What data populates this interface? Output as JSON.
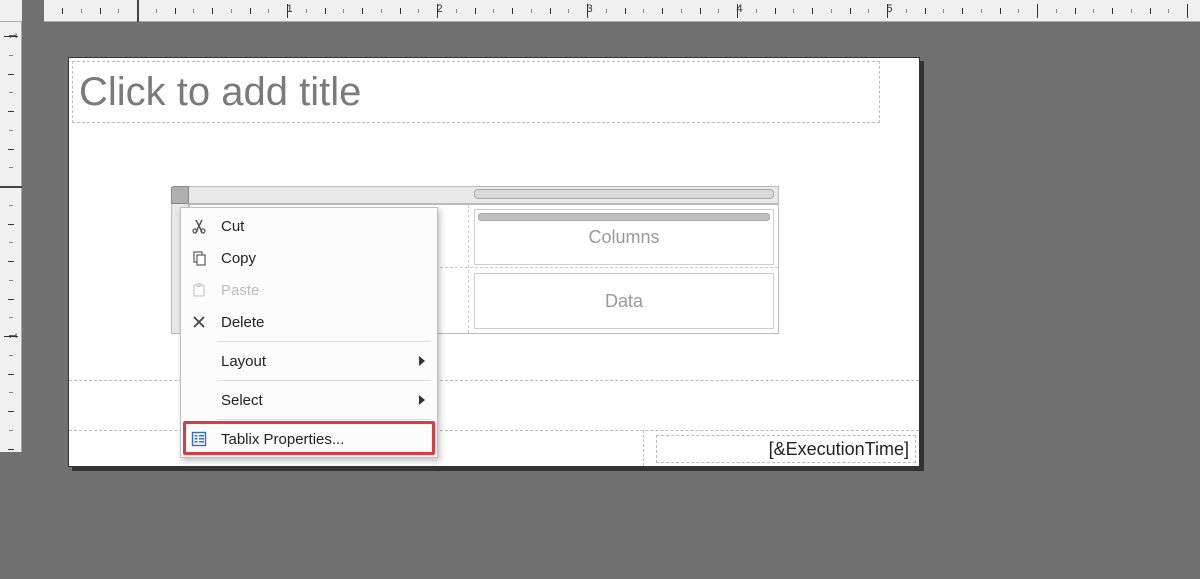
{
  "ruler": {
    "pxPerInch": 150,
    "hOriginPx": 137,
    "vOriginPx": 186,
    "hLabels": [
      1,
      2,
      3,
      4,
      5
    ],
    "vLabels": [
      1,
      2
    ]
  },
  "report": {
    "titlePlaceholder": "Click to add title",
    "footerExpression": "[&ExecutionTime]",
    "tablix": {
      "columnsLabel": "Columns",
      "dataLabel": "Data"
    }
  },
  "contextMenu": {
    "cut": "Cut",
    "copy": "Copy",
    "paste": "Paste",
    "delete": "Delete",
    "layout": "Layout",
    "select": "Select",
    "tablixProperties": "Tablix Properties..."
  }
}
